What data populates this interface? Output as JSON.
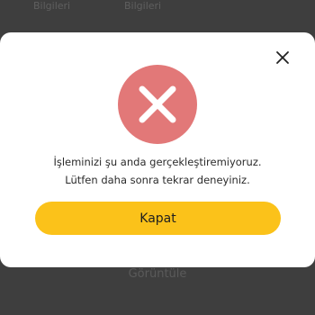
{
  "background": {
    "tabs": [
      "Bilgileri",
      "Bilgileri",
      ""
    ],
    "bottom_text": "Görüntüle"
  },
  "dialog": {
    "close_icon": "close-icon",
    "status_icon": "error-x-icon",
    "status_color": "#e27878",
    "message": "İşleminizi şu anda gerçekleştiremiyoruz. Lütfen daha sonra tekrar deneyiniz.",
    "button_label": "Kapat",
    "button_color": "#fbc21a"
  }
}
